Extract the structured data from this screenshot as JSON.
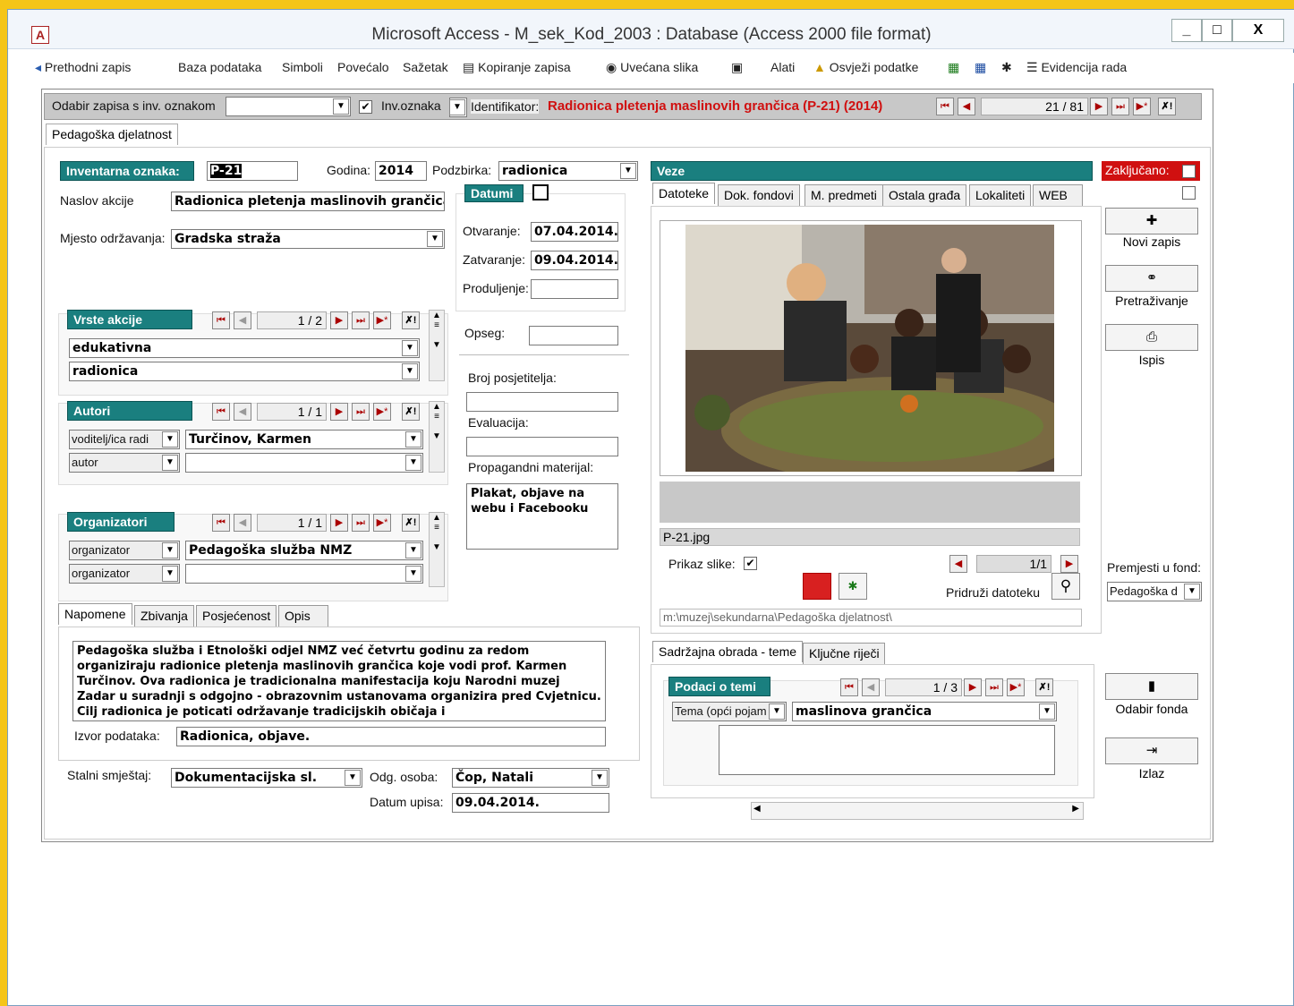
{
  "window": {
    "title": "Microsoft Access - M_sek_Kod_2003 : Database (Access 2000 file format)",
    "app_icon": "A",
    "min": "_",
    "max": "□",
    "close": "X"
  },
  "toolbar": {
    "prev": "Prethodni zapis",
    "db": "Baza podataka",
    "symbols": "Simboli",
    "magnifier": "Povećalo",
    "summary": "Sažetak",
    "copy": "Kopiranje zapisa",
    "zoom": "Uvećana slika",
    "tools": "Alati",
    "refresh": "Osvježi podatke",
    "worklog": "Evidencija rada"
  },
  "nav": {
    "select_label": "Odabir zapisa s inv. oznakom",
    "select_value": "",
    "inv_label": "Inv.oznaka",
    "ident_label": "Identifikator:",
    "ident_value": "Radionica pletenja maslinovih grančica (P-21) (2014)",
    "count": "21 / 81"
  },
  "main_tab": "Pedagoška djelatnost",
  "record": {
    "inv_label": "Inventarna oznaka:",
    "inv_value": "P-21",
    "year_label": "Godina:",
    "year_value": "2014",
    "sub_label": "Podzbirka:",
    "sub_value": "radionica",
    "title_label": "Naslov akcije",
    "title_value": "Radionica pletenja maslinovih grančica",
    "place_label": "Mjesto održavanja:",
    "place_value": "Gradska straža"
  },
  "dates": {
    "hdr": "Datumi",
    "open_label": "Otvaranje:",
    "open_value": "07.04.2014.",
    "close_label": "Zatvaranje:",
    "close_value": "09.04.2014.",
    "ext_label": "Produljenje:",
    "ext_value": ""
  },
  "types": {
    "hdr": "Vrste akcije",
    "count": "1 / 2",
    "items": [
      "edukativna",
      "radionica"
    ]
  },
  "authors": {
    "hdr": "Autori",
    "count": "1 / 1",
    "rows": [
      {
        "role": "voditelj/ica radi",
        "name": "Turčinov, Karmen"
      },
      {
        "role": "autor",
        "name": ""
      }
    ]
  },
  "organizers": {
    "hdr": "Organizatori",
    "count": "1 / 1",
    "rows": [
      {
        "role": "organizator",
        "name": "Pedagoška služba NMZ"
      },
      {
        "role": "organizator",
        "name": ""
      }
    ]
  },
  "right_fields": {
    "scope_label": "Opseg:",
    "visitors_label": "Broj posjetitelja:",
    "eval_label": "Evaluacija:",
    "promo_label": "Propagandni materijal:",
    "promo_value": "Plakat, objave na webu i Facebooku"
  },
  "bottom_tabs": [
    "Napomene",
    "Zbivanja",
    "Posjećenost",
    "Opis"
  ],
  "notes": {
    "text": "Pedagoška služba i Etnološki odjel NMZ već četvrtu godinu za redom organiziraju radionice pletenja maslinovih grančica koje vodi prof. Karmen Turčinov. Ova radionica je tradicionalna manifestacija koju Narodni muzej Zadar u suradnji s odgojno - obrazovnim ustanovama organizira pred Cvjetnicu. Cilj radionica je poticati održavanje tradicijskih običaja i",
    "source_label": "Izvor podataka:",
    "source_value": "Radionica, objave."
  },
  "location": {
    "label": "Stalni smještaj:",
    "value": "Dokumentacijska sl.",
    "person_label": "Odg. osoba:",
    "person_value": "Čop, Natali",
    "entry_label": "Datum upisa:",
    "entry_value": "09.04.2014."
  },
  "links": {
    "hdr": "Veze",
    "tabs": [
      "Datoteke",
      "Dok. fondovi",
      "M. predmeti",
      "Ostala građa",
      "Lokaliteti",
      "WEB"
    ],
    "filename": "P-21.jpg",
    "show_label": "Prikaz slike:",
    "img_count": "1/1",
    "attach_label": "Pridruži datoteku",
    "path": "m:\\muzej\\sekundarna\\Pedagoška djelatnost\\"
  },
  "topics": {
    "tabs": [
      "Sadržajna obrada - teme",
      "Ključne riječi"
    ],
    "hdr": "Podaci o temi",
    "count": "1 / 3",
    "type": "Tema (opći pojam",
    "value": "maslinova grančica"
  },
  "side": {
    "locked": "Zaključano:",
    "new": "Novi zapis",
    "search": "Pretraživanje",
    "print": "Ispis",
    "move_label": "Premjesti u fond:",
    "move_value": "Pedagoška d",
    "fund": "Odabir fonda",
    "exit": "Izlaz"
  },
  "colors": {
    "teal": "#1a7f7f",
    "ident_red": "#d01010"
  }
}
